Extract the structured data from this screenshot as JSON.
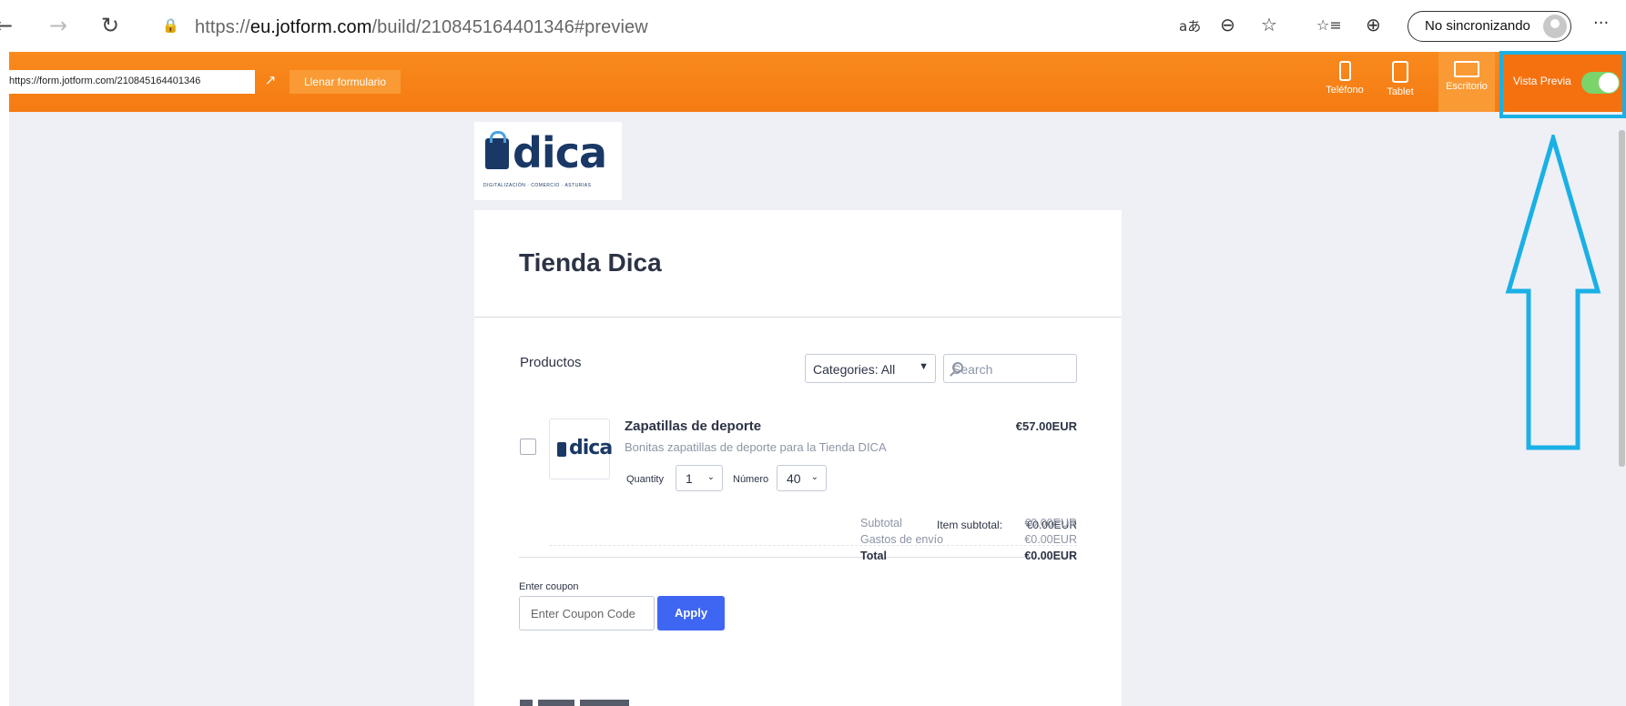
{
  "browser": {
    "url_host": "eu.jotform.com",
    "url_scheme": "https://",
    "url_path": "/build/210845164401346#preview",
    "sync_label": "No sincronizando",
    "icons": [
      "back-icon",
      "forward-icon",
      "refresh-icon",
      "lock-icon",
      "read-aloud-icon",
      "zoom-out-icon",
      "add-favorite-icon",
      "favorites-icon",
      "collections-icon",
      "profile-avatar-icon",
      "more-icon"
    ],
    "glyphs": {
      "back": "←",
      "forward": "→",
      "refresh": "↻",
      "lock": "🔒",
      "read_aloud": "aあ",
      "zoom_out": "⊖",
      "add_fav": "☆",
      "favorites": "☆≡",
      "collections": "⊕",
      "more": "···"
    }
  },
  "toolbar": {
    "form_url": "https://form.jotform.com/210845164401346",
    "open_external_icon": "external-link-icon",
    "open_external_glyph": "↗",
    "fill_button": "Llenar formulario",
    "devices": [
      {
        "label": "Teléfono",
        "icon": "phone-icon"
      },
      {
        "label": "Tablet",
        "icon": "tablet-icon"
      },
      {
        "label": "Escritorio",
        "icon": "desktop-icon",
        "active": true
      }
    ],
    "preview_label": "Vista Previa",
    "preview_on": true,
    "brand_color": "#f57b12"
  },
  "logo": {
    "text": "dica",
    "subtitle": "DIGITALIZACIÓN · COMERCIO · ASTURIAS"
  },
  "form": {
    "title": "Tienda Dica",
    "products_label": "Productos",
    "category_select": "Categories: All",
    "search_placeholder": "Search",
    "product": {
      "name": "Zapatillas de deporte",
      "description": "Bonitas zapatillas de deporte para la Tienda DICA",
      "price": "€57.00EUR",
      "thumb_text": "dica",
      "quantity_label": "Quantity",
      "quantity_value": "1",
      "number_label": "Número",
      "number_value": "40",
      "checked": false
    },
    "item_subtotal_label": "Item subtotal:",
    "item_subtotal_value": "€0.00EUR",
    "coupon_label": "Enter coupon",
    "coupon_placeholder": "Enter Coupon Code",
    "apply_button": "Apply",
    "totals": {
      "subtotal_label": "Subtotal",
      "subtotal_value": "€0.00EUR",
      "shipping_label": "Gastos de envío",
      "shipping_value": "€0.00EUR",
      "total_label": "Total",
      "total_value": "€0.00EUR"
    },
    "accent_color": "#3f66f2"
  },
  "annotation": {
    "color": "#1bb0e5"
  }
}
